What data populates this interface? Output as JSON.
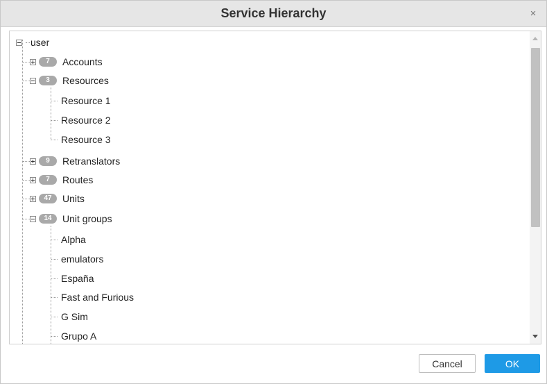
{
  "dialog": {
    "title": "Service Hierarchy",
    "close_glyph": "×"
  },
  "tree": {
    "root": {
      "label": "user",
      "expanded": true
    },
    "accounts": {
      "label": "Accounts",
      "count": "7",
      "expanded": false
    },
    "resources": {
      "label": "Resources",
      "count": "3",
      "expanded": true,
      "children": [
        "Resource 1",
        "Resource 2",
        "Resource 3"
      ]
    },
    "retranslators": {
      "label": "Retranslators",
      "count": "9",
      "expanded": false
    },
    "routes": {
      "label": "Routes",
      "count": "7",
      "expanded": false
    },
    "units": {
      "label": "Units",
      "count": "47",
      "expanded": false
    },
    "unit_groups": {
      "label": "Unit groups",
      "count": "14",
      "expanded": true,
      "children": [
        "Alpha",
        "emulators",
        "España",
        "Fast and Furious",
        "G Sim",
        "Grupo A"
      ]
    }
  },
  "buttons": {
    "cancel": "Cancel",
    "ok": "OK"
  },
  "colors": {
    "ok_button": "#1e9ae6",
    "badge": "#a9a9a9",
    "titlebar": "#e6e6e6"
  }
}
